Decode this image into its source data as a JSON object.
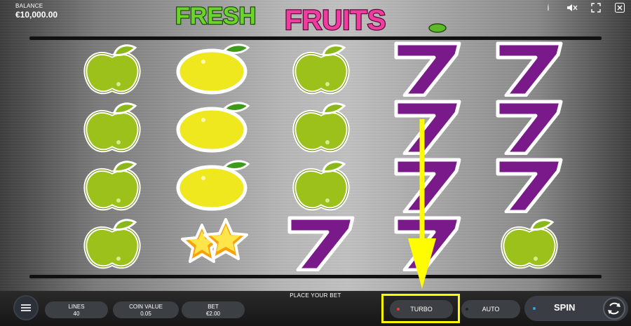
{
  "balance": {
    "label": "BALANCE",
    "value": "€10,000.00"
  },
  "logo": {
    "word1": "FRESH",
    "word2": "FRUITS"
  },
  "top_icons": [
    "info-icon",
    "sound-icon",
    "fullscreen-icon",
    "close-icon"
  ],
  "reels": [
    [
      "apple",
      "apple",
      "apple",
      "apple"
    ],
    [
      "lemon",
      "lemon",
      "lemon",
      "stars"
    ],
    [
      "apple",
      "apple",
      "apple",
      "seven"
    ],
    [
      "seven",
      "seven",
      "seven",
      "seven"
    ],
    [
      "seven",
      "seven",
      "seven",
      "apple"
    ]
  ],
  "bet_bar": {
    "title": "PLACE YOUR BET",
    "lines": {
      "label": "LINES",
      "value": "40"
    },
    "coin_value": {
      "label": "COIN VALUE",
      "value": "0.05"
    },
    "bet": {
      "label": "BET",
      "value": "€2.00"
    },
    "turbo_label": "TURBO",
    "auto_label": "AUTO",
    "spin_label": "SPIN"
  },
  "colors": {
    "highlight": "#fffb00",
    "apple": "#9bc11a",
    "lemon": "#f0e81e",
    "seven": "#7a1a8a",
    "star": "#f5a20c",
    "turbo_dot": "#e63c3c",
    "spin_dot": "#3aa0e6"
  }
}
